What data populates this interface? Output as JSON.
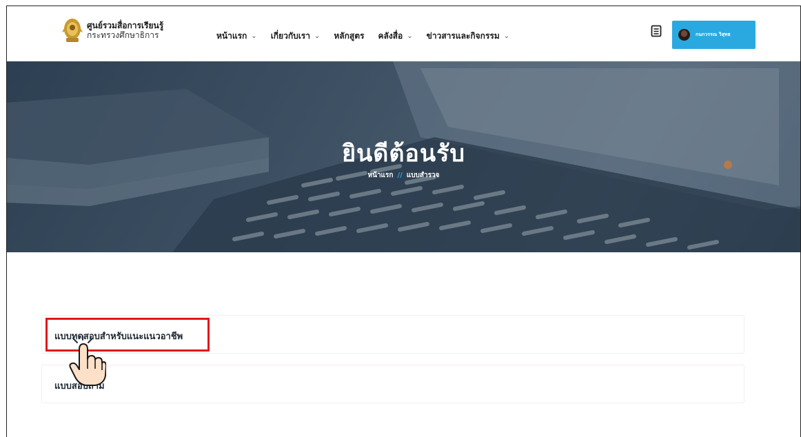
{
  "header": {
    "brand_title": "ศูนย์รวมสื่อการเรียนรู้",
    "brand_subtitle": "กระทรวงศึกษาธิการ",
    "nav": [
      {
        "label": "หน้าแรก",
        "has_dropdown": true
      },
      {
        "label": "เกี่ยวกับเรา",
        "has_dropdown": true
      },
      {
        "label": "หลักสูตร",
        "has_dropdown": false
      },
      {
        "label": "คลังสื่อ",
        "has_dropdown": true
      },
      {
        "label": "ข่าวสารและกิจกรรม",
        "has_dropdown": true
      }
    ],
    "user_name": "กนกวรรณ วิสุทธ",
    "accent_color": "#2aa9e0"
  },
  "hero": {
    "title": "ยินดีต้อนรับ",
    "breadcrumb_home": "หน้าแรก",
    "breadcrumb_separator": "//",
    "breadcrumb_current": "แบบสำรวจ"
  },
  "cards": [
    {
      "label": "แบบทดสอบสำหรับแนะแนวอาชีพ"
    },
    {
      "label": "แบบสอบถาม"
    }
  ],
  "icons": [
    "emblem-logo",
    "chevron-down-icon",
    "book-icon",
    "avatar",
    "pointing-hand-icon"
  ],
  "highlight_color": "#e01919"
}
